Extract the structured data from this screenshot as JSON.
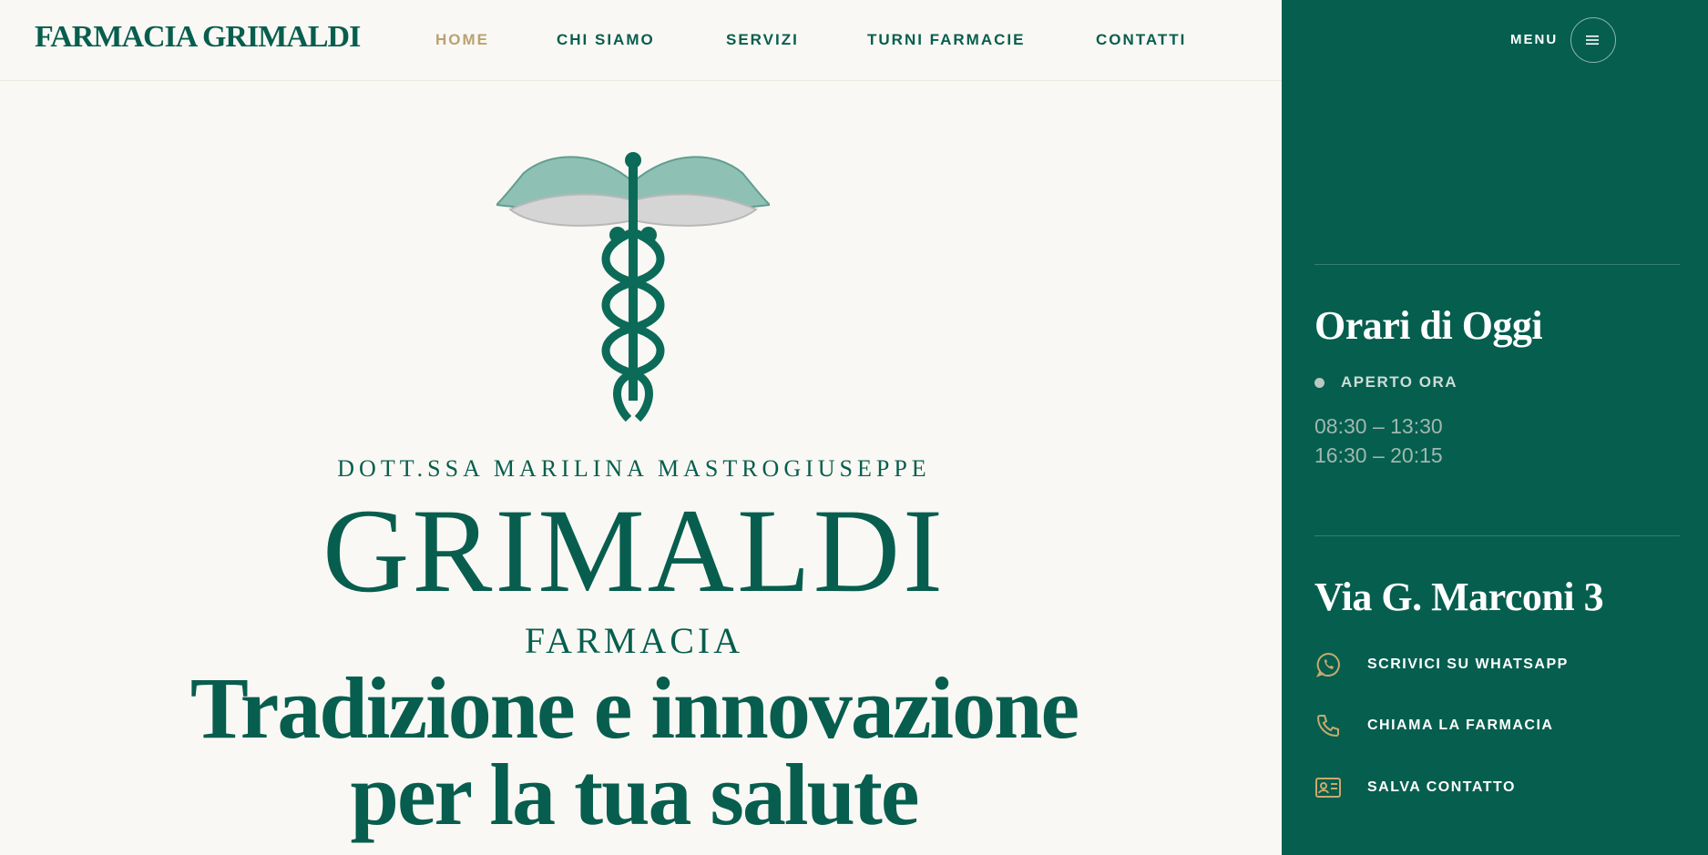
{
  "header": {
    "brand": "FARMACIA GRIMALDI",
    "nav": [
      {
        "label": "HOME",
        "active": true
      },
      {
        "label": "CHI SIAMO"
      },
      {
        "label": "SERVIZI"
      },
      {
        "label": "TURNI FARMACIE"
      },
      {
        "label": "CONTATTI"
      }
    ]
  },
  "panel": {
    "menu_label": "MENU",
    "menu_icon": "hamburger-icon",
    "hours_title": "Orari di Oggi",
    "status": "APERTO ORA",
    "hours": [
      "08:30 – 13:30",
      "16:30 – 20:15"
    ],
    "address": "Via G. Marconi 3",
    "actions": [
      {
        "label": "SCRIVICI SU WHATSAPP",
        "icon": "whatsapp-icon"
      },
      {
        "label": "CHIAMA LA FARMACIA",
        "icon": "phone-icon"
      },
      {
        "label": "SALVA CONTATTO",
        "icon": "contact-card-icon"
      }
    ]
  },
  "hero": {
    "logo_icon": "caduceus-icon",
    "doctor": "DOTT.SSA MARILINA MASTROGIUSEPPE",
    "name": "GRIMALDI",
    "subtitle": "FARMACIA",
    "headline_line1": "Tradizione e innovazione",
    "headline_line2": "per la tua salute"
  },
  "colors": {
    "primary": "#065e4e",
    "accent_gold": "#b9a271",
    "background": "#faf8f4"
  }
}
